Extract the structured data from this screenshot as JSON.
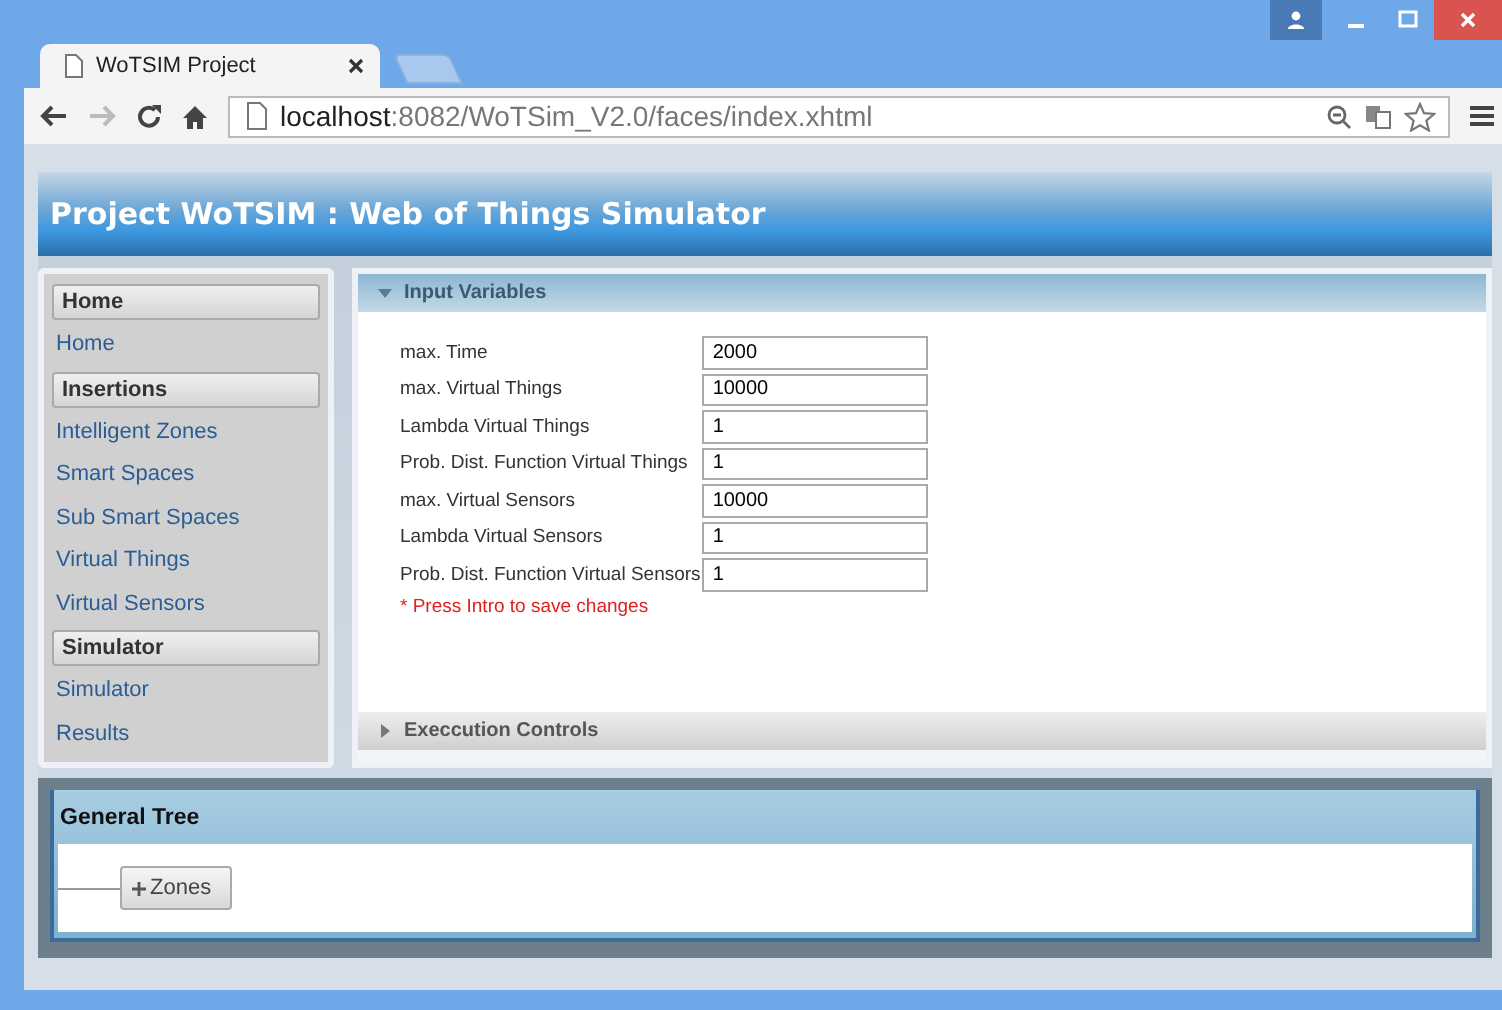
{
  "browser": {
    "tab_title": "WoTSIM Project",
    "url_host": "localhost",
    "url_rest": ":8082/WoTSim_V2.0/faces/index.xhtml"
  },
  "header": {
    "title": "Project WoTSIM : Web of Things Simulator"
  },
  "sidebar": {
    "items": [
      {
        "kind": "header",
        "label": "Home"
      },
      {
        "kind": "link",
        "label": "Home"
      },
      {
        "kind": "header",
        "label": "Insertions"
      },
      {
        "kind": "link",
        "label": "Intelligent Zones"
      },
      {
        "kind": "link",
        "label": "Smart Spaces"
      },
      {
        "kind": "link",
        "label": "Sub Smart Spaces"
      },
      {
        "kind": "link",
        "label": "Virtual Things"
      },
      {
        "kind": "link",
        "label": "Virtual Sensors"
      },
      {
        "kind": "header",
        "label": "Simulator"
      },
      {
        "kind": "link",
        "label": "Simulator"
      },
      {
        "kind": "link",
        "label": "Results"
      }
    ]
  },
  "panels": [
    {
      "title": "Input Variables",
      "expanded": true,
      "fields": [
        {
          "label": "max. Time",
          "value": "2000"
        },
        {
          "label": "max. Virtual Things",
          "value": "10000"
        },
        {
          "label": "Lambda Virtual Things",
          "value": "1"
        },
        {
          "label": "Prob. Dist. Function Virtual Things",
          "value": "1"
        },
        {
          "label": "max. Virtual Sensors",
          "value": "10000"
        },
        {
          "label": "Lambda Virtual Sensors",
          "value": "1"
        },
        {
          "label": "Prob. Dist. Function Virtual Sensors",
          "value": "1"
        }
      ],
      "note": "* Press Intro to save changes"
    },
    {
      "title": "Execcution Controls",
      "expanded": false
    }
  ],
  "tree": {
    "title": "General Tree",
    "nodes": [
      {
        "label": "Zones",
        "expanded": false
      }
    ]
  }
}
